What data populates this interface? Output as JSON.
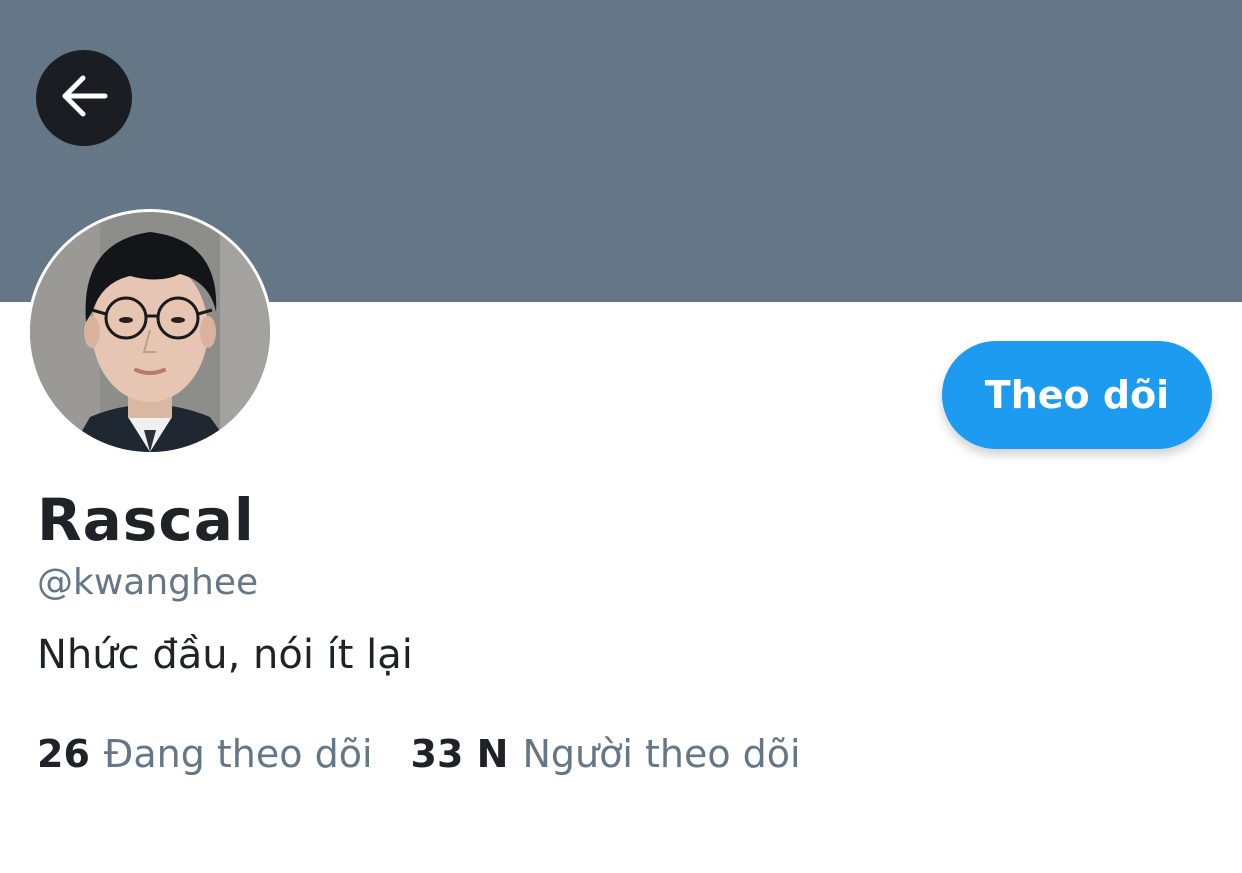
{
  "header": {
    "banner_color": "#657786",
    "back_icon": "arrow-left-icon"
  },
  "profile": {
    "display_name": "Rascal",
    "handle": "@kwanghee",
    "bio": "Nhức đầu, nói ít lại",
    "follow_label": "Theo dõi",
    "accent_color": "#1d9bf0"
  },
  "stats": {
    "following_count": "26",
    "following_label": "Đang theo dõi",
    "followers_count": "33 N",
    "followers_label": "Người theo dõi"
  }
}
